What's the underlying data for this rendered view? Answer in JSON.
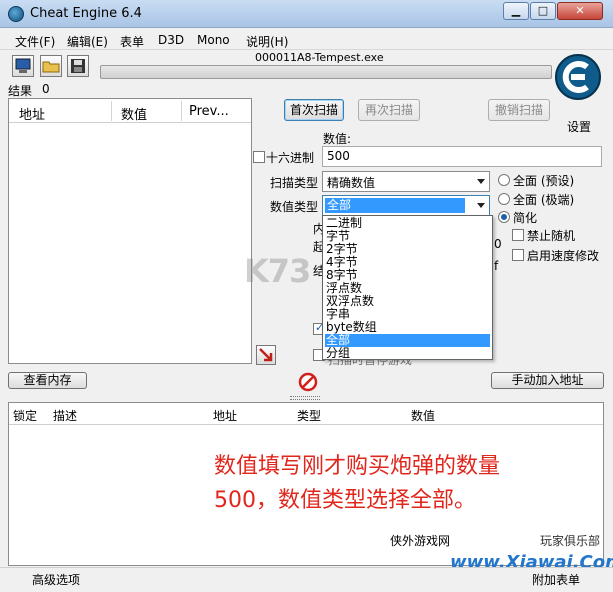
{
  "window": {
    "title": "Cheat Engine 6.4"
  },
  "menu": [
    "文件(F)",
    "编辑(E)",
    "表单",
    "D3D",
    "Mono",
    "说明(H)"
  ],
  "process_title": "000011A8-Tempest.exe",
  "settings_label": "设置",
  "results": {
    "label": "结果",
    "count": "0"
  },
  "address_list": {
    "columns": [
      "地址",
      "数值",
      "Prev..."
    ]
  },
  "scan": {
    "first_scan": "首次扫描",
    "next_scan": "再次扫描",
    "undo_scan": "撤销扫描",
    "value_label": "数值:",
    "hex_label": "十六进制",
    "value": "500",
    "scan_type_label": "扫描类型",
    "scan_type": "精确数值",
    "value_type_label": "数值类型",
    "value_type": "全部"
  },
  "value_type_options": [
    "二进制",
    "字节",
    "2字节",
    "4字节",
    "8字节",
    "浮点数",
    "双浮点数",
    "字串",
    "byte数组",
    "全部",
    "分组"
  ],
  "value_type_selected_index": 9,
  "options": {
    "radio_full_default": "全面 (预设)",
    "radio_full_max": "全面 (极端)",
    "radio_simple": "简化",
    "disable_random": "禁止随机",
    "speedhack": "启用速度修改"
  },
  "partial_hidden": {
    "left_top": "内",
    "left_mid": "起",
    "left_mid2": "结",
    "right_f": "f",
    "right_zero": "0",
    "bottom_text": "扫描时暂停游戏"
  },
  "buttons": {
    "view_memory": "查看内存",
    "add_manual": "手动加入地址"
  },
  "cheat_table": {
    "columns": [
      "锁定",
      "描述",
      "地址",
      "类型",
      "数值"
    ]
  },
  "instruction": [
    "数值填写刚才购买炮弹的数量",
    "500，数值类型选择全部。"
  ],
  "watermark": {
    "left": "侠外游戏网",
    "right": "玩家俱乐部",
    "logo": "www.Xiawai.Com",
    "k73": "K73"
  },
  "status": {
    "advanced": "高级选项",
    "attach": "附加表单"
  }
}
